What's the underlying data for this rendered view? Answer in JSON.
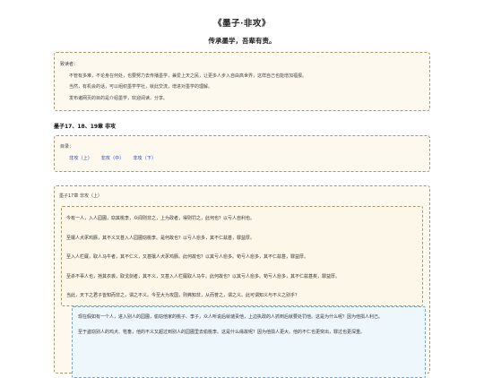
{
  "header": {
    "title": "《墨子·非攻》",
    "subtitle": "传承墨学，吾辈有责。"
  },
  "intro": {
    "greeting": "致读者：",
    "lines": [
      "不管有多难，不论身在何处，也要努力去传播墨学，兼爱上天之民，让更多人步入自由高世界，这样自己也能增加福报。",
      "当然，有机会的话，可以组织墨学学社，就此交流，增进对墨学的理解。",
      "发布诸网页的目的是介绍墨学，欢迎阅读、分享。"
    ]
  },
  "section": {
    "title": "墨子17、18、19章 非攻"
  },
  "toc": {
    "label": "目录：",
    "links": [
      "非攻（上）",
      "非攻（中）",
      "非攻（下）"
    ]
  },
  "chapter": {
    "label": "墨子17章 非攻（上）",
    "original": [
      "今有一人，入人园圃，窃其桃李，众闻则非之，上为政者，得则罚之，此何也？以亏人自利也。",
      "至攘人犬豕鸡豚，其不义又甚入人园圃窃桃李。是何故也？以亏人愈多，其不仁兹甚，罪益厚。",
      "至入人栏厩，取人马牛者，其不仁义，又甚攘人犬豕鸡豚。此何故也？以其亏人愈多。苟亏人愈多，其不仁兹甚，罪益厚。",
      "至杀不辜人也，扡其衣裘，取戈剑者，其不义，又甚入人栏厩取人马牛。此何故也？以其亏人愈多。苟亏人愈多，其不仁兹甚矣，罪益厚。",
      "当此，天下之君子皆知而非之，谓之不义。今至大为攻国，则弗知非，从而誉之，谓之义。此可谓知义与不义之别乎？"
    ],
    "translation": [
      "现在假如有一个人，进入别人的园圃，偷窃他家的桃子、李子，众人听说后就谴责他，上边执政的人抓到后就要处罚他。这是为什么呢？因为他损人利己。",
      "至于盗窃别人的鸡犬、牲畜，他的不义又超过到别人的园圃里去偷桃李。这是什么缘故呢？因为他损人更大。他的不仁也更突出，罪过也更深重。"
    ]
  }
}
